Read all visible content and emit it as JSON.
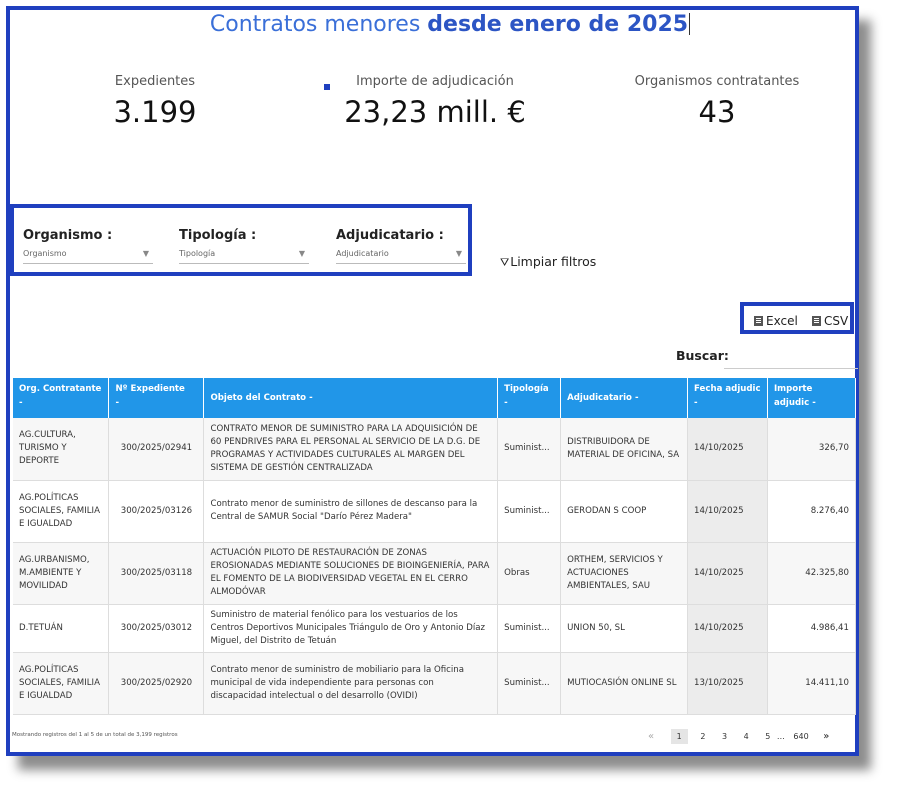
{
  "header": {
    "title_light": "Contratos menores ",
    "title_bold": "desde enero de 2025"
  },
  "kpis": [
    {
      "label": "Expedientes",
      "value": "3.199"
    },
    {
      "label": "Importe de adjudicación",
      "value": "23,23 mill. €"
    },
    {
      "label": "Organismos contratantes",
      "value": "43"
    }
  ],
  "filters": {
    "organismo": {
      "label": "Organismo :",
      "placeholder": "Organismo"
    },
    "tipologia": {
      "label": "Tipología :",
      "placeholder": "Tipología"
    },
    "adjudicatario": {
      "label": "Adjudicatario :",
      "placeholder": "Adjudicatario"
    },
    "clear_label": "Limpiar filtros"
  },
  "export": {
    "excel_label": "Excel",
    "csv_label": "CSV"
  },
  "search": {
    "label": "Buscar:"
  },
  "table": {
    "columns": [
      "Org. Contratante",
      "Nº Expediente",
      "Objeto del Contrato",
      "Tipología",
      "Adjudicatario",
      "Fecha adjudic",
      "Importe adjudic"
    ],
    "sort_glyph": "-",
    "rows": [
      {
        "org": "AG.CULTURA, TURISMO Y DEPORTE",
        "exp": "300/2025/02941",
        "obj": "CONTRATO MENOR DE SUMINISTRO PARA LA ADQUISICIÓN DE 60 PENDRIVES PARA EL PERSONAL AL SERVICIO DE LA D.G. DE PROGRAMAS Y ACTIVIDADES CULTURALES AL MARGEN DEL SISTEMA DE GESTIÓN CENTRALIZADA",
        "tip": "Suminist...",
        "adj": "DISTRIBUIDORA DE MATERIAL DE OFICINA, SA",
        "fecha": "14/10/2025",
        "importe": "326,70"
      },
      {
        "org": "AG.POLÍTICAS SOCIALES, FAMILIA E IGUALDAD",
        "exp": "300/2025/03126",
        "obj": "Contrato menor de suministro de sillones de descanso para la Central de SAMUR Social \"Darío Pérez Madera\"",
        "tip": "Suminist...",
        "adj": "GERODAN S COOP",
        "fecha": "14/10/2025",
        "importe": "8.276,40"
      },
      {
        "org": "AG.URBANISMO, M.AMBIENTE Y MOVILIDAD",
        "exp": "300/2025/03118",
        "obj": "ACTUACIÓN PILOTO DE RESTAURACIÓN DE ZONAS EROSIONADAS MEDIANTE SOLUCIONES DE BIOINGENIERÍA, PARA EL FOMENTO DE LA BIODIVERSIDAD VEGETAL EN EL CERRO ALMODÓVAR",
        "tip": "Obras",
        "adj": "ORTHEM, SERVICIOS Y ACTUACIONES AMBIENTALES, SAU",
        "fecha": "14/10/2025",
        "importe": "42.325,80"
      },
      {
        "org": "D.TETUÁN",
        "exp": "300/2025/03012",
        "obj": "Suministro de material fenólico para los vestuarios de los Centros Deportivos Municipales Triángulo de Oro y Antonio Díaz Miguel, del Distrito de Tetuán",
        "tip": "Suminist...",
        "adj": "UNION 50, SL",
        "fecha": "14/10/2025",
        "importe": "4.986,41"
      },
      {
        "org": "AG.POLÍTICAS SOCIALES, FAMILIA E IGUALDAD",
        "exp": "300/2025/02920",
        "obj": "Contrato menor de suministro de mobiliario para la Oficina municipal de vida independiente para personas con discapacidad intelectual o del desarrollo (OVIDI)",
        "tip": "Suminist...",
        "adj": "MUTIOCASIÓN ONLINE SL",
        "fecha": "13/10/2025",
        "importe": "14.411,10"
      }
    ]
  },
  "footer": {
    "info": "Mostrando registros del 1 al 5 de un total de 3,199 registros"
  },
  "pagination": {
    "prev": "«",
    "pages": [
      "1",
      "2",
      "3",
      "4",
      "5"
    ],
    "ellipsis": "…",
    "last": "640",
    "next": "»"
  },
  "colors": {
    "frame": "#1f3fbf",
    "header_bg": "#2196e8",
    "title": "#3a6fd8"
  }
}
